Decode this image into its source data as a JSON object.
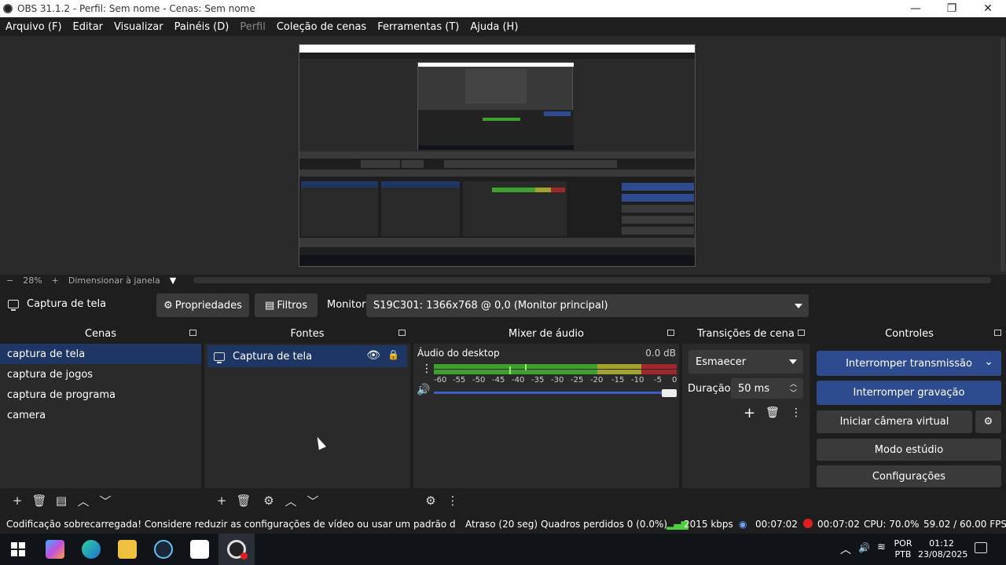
{
  "window": {
    "title": "OBS 31.1.2 - Perfil: Sem nome - Cenas: Sem nome"
  },
  "menu": [
    "Arquivo (F)",
    "Editar",
    "Visualizar",
    "Painéis (D)",
    "Perfil",
    "Coleção de cenas",
    "Ferramentas (T)",
    "Ajuda (H)"
  ],
  "zoom": {
    "minus": "−",
    "value": "28%",
    "plus": "+",
    "mode": "Dimensionar à janela"
  },
  "source_toolbar": {
    "source_name": "Captura de tela",
    "properties": "Propriedades",
    "filters": "Filtros",
    "monitor_label": "Monitor",
    "monitor_value": "S19C301: 1366x768 @ 0,0 (Monitor principal)"
  },
  "scenes": {
    "title": "Cenas",
    "items": [
      "captura de tela",
      "captura de jogos",
      "captura de programa",
      "camera"
    ]
  },
  "sources": {
    "title": "Fontes",
    "items": [
      "Captura de tela"
    ]
  },
  "mixer": {
    "title": "Mixer de áudio",
    "channel": "Áudio do desktop",
    "level": "0.0 dB",
    "scale": [
      "-60",
      "-55",
      "-50",
      "-45",
      "-40",
      "-35",
      "-30",
      "-25",
      "-20",
      "-15",
      "-10",
      "-5",
      "0"
    ]
  },
  "transitions": {
    "title": "Transições de cena",
    "type": "Esmaecer",
    "duration_label": "Duração",
    "duration_value": "50 ms"
  },
  "controls": {
    "title": "Controles",
    "stop_stream": "Interromper transmissão",
    "stop_record": "Interromper gravação",
    "virtual_cam": "Iniciar câmera virtual",
    "studio_mode": "Modo estúdio",
    "settings": "Configurações"
  },
  "status": {
    "warning": "Codificação sobrecarregada! Considere reduzir as configurações de vídeo ou usar um padrão de codific",
    "delay": "Atraso (20 seg)",
    "dropped": "Quadros perdidos 0 (0.0%)",
    "bitrate": "2015 kbps",
    "stream_time": "00:07:02",
    "record_time": "00:07:02",
    "cpu": "CPU: 70.0%",
    "fps": "59.02 / 60.00 FPS"
  },
  "taskbar": {
    "lang1": "POR",
    "lang2": "PTB",
    "time": "01:12",
    "date": "23/08/2025"
  },
  "colors": {
    "accent": "#1d3664",
    "active_button": "#2d4b8e",
    "meter_green": "#3f9f2f",
    "meter_yellow": "#a3a22c",
    "meter_red": "#a0282a",
    "record_red": "#e02020"
  }
}
